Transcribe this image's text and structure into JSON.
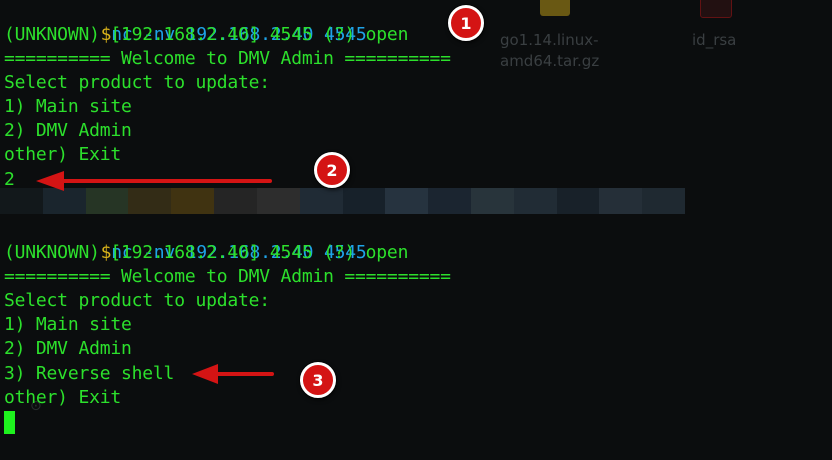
{
  "desktop": {
    "files": [
      {
        "name_line1": "go1.14.linux-",
        "name_line2": "amd64.tar.gz"
      },
      {
        "name_line1": "id_rsa",
        "name_line2": ""
      }
    ],
    "icon_colors": [
      "#c8a418",
      "#b81818",
      "#2a6a8a",
      "#ae7a1a"
    ]
  },
  "terminal": {
    "colors": {
      "text": "#2ce02c",
      "prompt": "#d8b21a",
      "command": "#1fa3e8",
      "cursor": "#1ef21e"
    },
    "session1": {
      "prompt": "$",
      "command": "nc -nv 192.168.2.40 4545",
      "lines": [
        "(UNKNOWN) [192.168.2.40] 4545 (?) open",
        "========== Welcome to DMV Admin ==========",
        "Select product to update:",
        "1) Main site",
        "2) DMV Admin",
        "other) Exit",
        "2"
      ]
    },
    "session2": {
      "prompt": "$",
      "command": "nc -nv 192.168.2.40 4545",
      "lines": [
        "(UNKNOWN) [192.168.2.40] 4545 (?) open",
        "========== Welcome to DMV Admin ==========",
        "Select product to update:",
        "1) Main site",
        "2) DMV Admin",
        "3) Reverse shell",
        "other) Exit"
      ]
    }
  },
  "annotations": {
    "color": "#d41414",
    "badges": [
      "1",
      "2",
      "3"
    ]
  }
}
